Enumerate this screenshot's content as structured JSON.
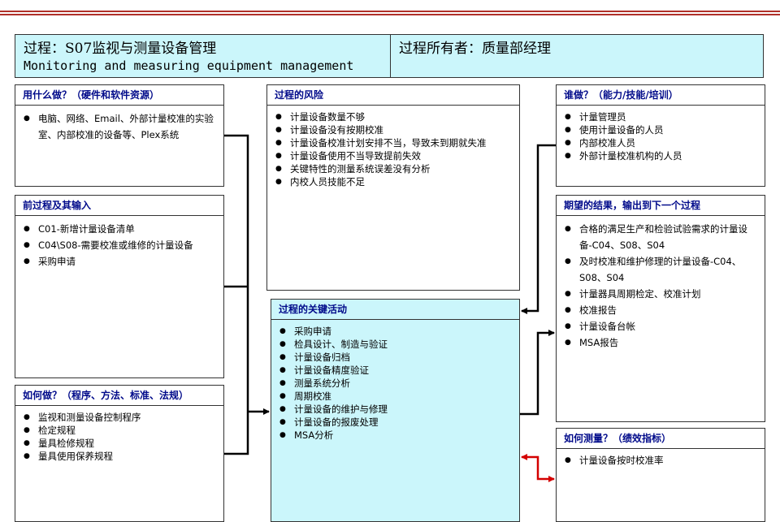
{
  "header": {
    "process_zh": "过程：S07监视与测量设备管理",
    "process_en": "Monitoring and measuring equipment management",
    "owner": "过程所有者：质量部经理"
  },
  "resources": {
    "title": "用什么做？（硬件和软件资源）",
    "items": [
      "电脑、网络、Email、外部计量校准的实验室、内部校准的设备等、Plex系统"
    ]
  },
  "risks": {
    "title": "过程的风险",
    "items": [
      "计量设备数量不够",
      "计量设备没有按期校准",
      "计量设备校准计划安排不当，导致未到期就失准",
      "计量设备使用不当导致提前失效",
      "关键特性的测量系统误差没有分析",
      "内校人员技能不足"
    ]
  },
  "who": {
    "title": "谁做？（能力/技能/培训）",
    "items": [
      "计量管理员",
      "使用计量设备的人员",
      "内部校准人员",
      "外部计量校准机构的人员"
    ]
  },
  "inputs": {
    "title": "前过程及其输入",
    "items": [
      "C01-新增计量设备清单",
      "C04\\S08-需要校准或维修的计量设备",
      "采购申请"
    ]
  },
  "outputs": {
    "title": "期望的结果，输出到下一个过程",
    "items": [
      "合格的满足生产和检验试验需求的计量设备-C04、S08、S04",
      "及时校准和维护修理的计量设备-C04、S08、S04",
      "计量器具周期检定、校准计划",
      "校准报告",
      "计量设备台帐",
      "MSA报告"
    ]
  },
  "activities": {
    "title": "过程的关键活动",
    "items": [
      "采购申请",
      "检具设计、制造与验证",
      "计量设备归档",
      "计量设备精度验证",
      "测量系统分析",
      "周期校准",
      "计量设备的维护与修理",
      "计量设备的报废处理",
      "MSA分析"
    ]
  },
  "how": {
    "title": "如何做？（程序、方法、标准、法规）",
    "items": [
      "监视和测量设备控制程序",
      "检定规程",
      "量具检修规程",
      "量具使用保养规程"
    ]
  },
  "measure": {
    "title": "如何测量？（绩效指标）",
    "items": [
      "计量设备按时校准率"
    ]
  },
  "colors": {
    "cyan": "#cbf6fb",
    "title_blue": "#000a8a",
    "red_arrow": "#d40000",
    "top_rule": "#b0302a"
  }
}
